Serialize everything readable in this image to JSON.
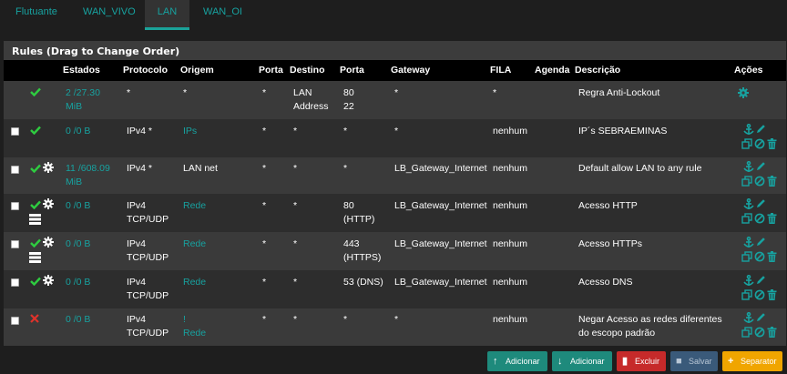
{
  "tabs": [
    "Flutuante",
    "WAN_VIVO",
    "LAN",
    "WAN_OI"
  ],
  "panel_title": "Rules (Drag to Change Order)",
  "columns": {
    "estados": "Estados",
    "protocolo": "Protocolo",
    "origem": "Origem",
    "porta": "Porta",
    "destino": "Destino",
    "porta2": "Porta",
    "gateway": "Gateway",
    "fila": "FILA",
    "agenda": "Agenda",
    "descricao": "Descrição",
    "acoes": "Ações"
  },
  "rows": [
    {
      "states1": "2 /27.30",
      "states2": "MiB",
      "proto1": "*",
      "proto2": "",
      "origem1": "*",
      "origem2": "",
      "sport": "*",
      "dest1": "LAN",
      "dest2": "Address",
      "dport1": "80",
      "dport2": "22",
      "gateway": "*",
      "fila": "*",
      "desc1": "Regra Anti-Lockout",
      "desc2": ""
    },
    {
      "states1": "0 /0 B",
      "states2": "",
      "proto1": "IPv4 *",
      "proto2": "",
      "origem1": "IPs",
      "origem2": "",
      "sport": "*",
      "dest1": "*",
      "dest2": "",
      "dport1": "*",
      "dport2": "",
      "gateway": "*",
      "fila": "nenhum",
      "desc1": "IP´s SEBRAEMINAS",
      "desc2": ""
    },
    {
      "states1": "11 /608.09",
      "states2": "MiB",
      "proto1": "IPv4 *",
      "proto2": "",
      "origem1": "LAN net",
      "origem2": "",
      "sport": "*",
      "dest1": "*",
      "dest2": "",
      "dport1": "*",
      "dport2": "",
      "gateway": "LB_Gateway_Internet",
      "fila": "nenhum",
      "desc1": "Default allow LAN to any rule",
      "desc2": ""
    },
    {
      "states1": "0 /0 B",
      "states2": "",
      "proto1": "IPv4",
      "proto2": "TCP/UDP",
      "origem1": "Rede",
      "origem2": "",
      "sport": "*",
      "dest1": "*",
      "dest2": "",
      "dport1": "80",
      "dport2": "(HTTP)",
      "gateway": "LB_Gateway_Internet",
      "fila": "nenhum",
      "desc1": "Acesso HTTP",
      "desc2": ""
    },
    {
      "states1": "0 /0 B",
      "states2": "",
      "proto1": "IPv4",
      "proto2": "TCP/UDP",
      "origem1": "Rede",
      "origem2": "",
      "sport": "*",
      "dest1": "*",
      "dest2": "",
      "dport1": "443",
      "dport2": "(HTTPS)",
      "gateway": "LB_Gateway_Internet",
      "fila": "nenhum",
      "desc1": "Acesso HTTPs",
      "desc2": ""
    },
    {
      "states1": "0 /0 B",
      "states2": "",
      "proto1": "IPv4",
      "proto2": "TCP/UDP",
      "origem1": "Rede",
      "origem2": "",
      "sport": "*",
      "dest1": "*",
      "dest2": "",
      "dport1": "53 (DNS)",
      "dport2": "",
      "gateway": "LB_Gateway_Internet",
      "fila": "nenhum",
      "desc1": "Acesso DNS",
      "desc2": ""
    },
    {
      "states1": "0 /0 B",
      "states2": "",
      "proto1": "IPv4",
      "proto2": "TCP/UDP",
      "origem1": "!",
      "origem2": "Rede",
      "sport": "*",
      "dest1": "*",
      "dest2": "",
      "dport1": "*",
      "dport2": "",
      "gateway": "*",
      "fila": "nenhum",
      "desc1": "Negar Acesso as redes diferentes",
      "desc2": "do escopo padrão"
    }
  ],
  "buttons": {
    "add_top": "Adicionar",
    "add_bottom": "Adicionar",
    "delete": "Excluir",
    "save": "Salvar",
    "separator": "Separator"
  },
  "colors": {
    "accent": "#17a2a0",
    "pass": "#2ecc40",
    "block": "#e0322a",
    "header": "#000000"
  },
  "icons": {
    "pass": "check-icon",
    "block": "times-icon",
    "advanced": "gear-icon",
    "gateway": "server-icon",
    "anchor": "anchor-icon",
    "edit": "pencil-icon",
    "copy": "copy-icon",
    "disable": "ban-icon",
    "delete": "trash-icon"
  }
}
